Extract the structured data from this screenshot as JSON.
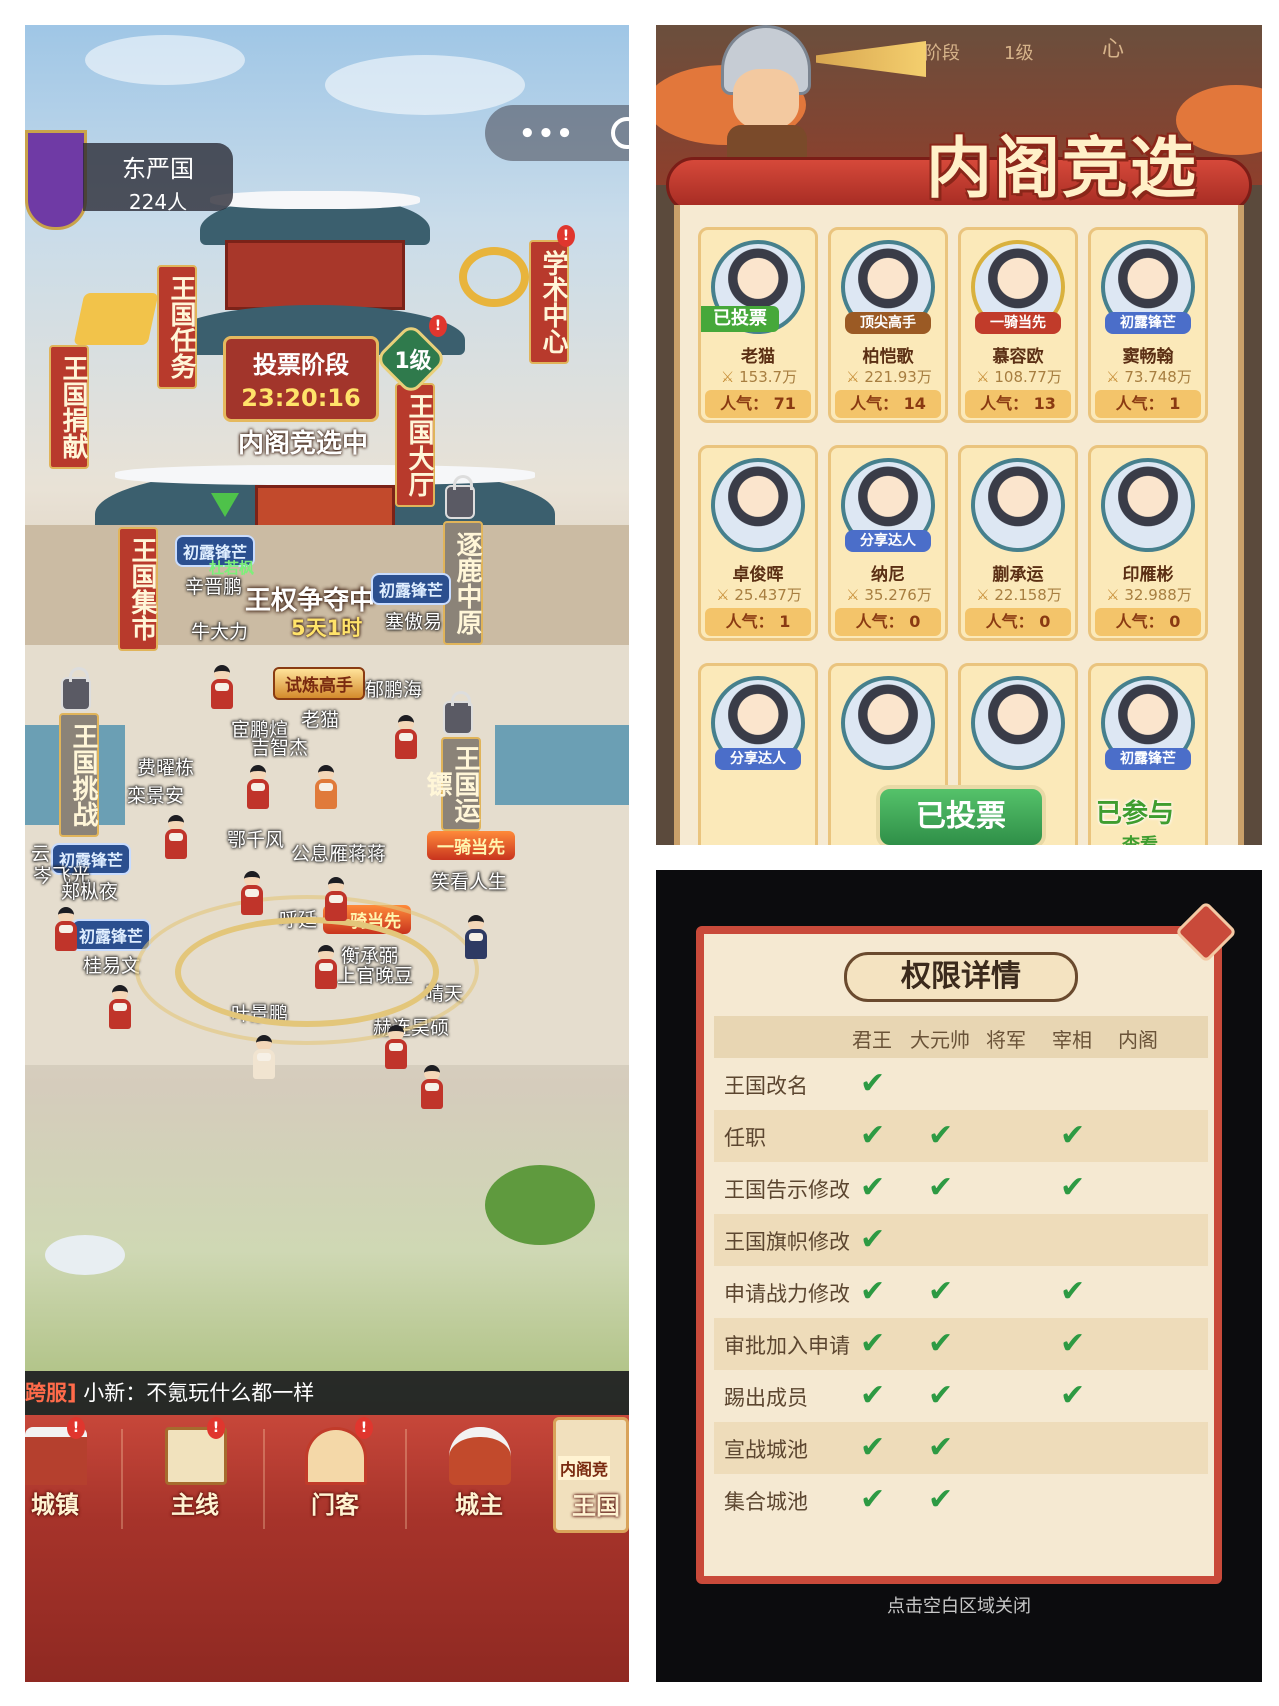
{
  "left_panel": {
    "kingdom": {
      "name": "东严国",
      "members": "224人"
    },
    "menu_dots": "•••",
    "side_banners": {
      "academy": "学术中心",
      "kingdom_tasks": "王国任务",
      "kingdom_donation": "王国捐献",
      "kingdom_hall": "王国大厅",
      "kingdom_market": "王国集市",
      "deer_hunt": "逐鹿中原",
      "kingdom_challenge": "王国挑战",
      "kingdom_escort": "王国运镖"
    },
    "vote_board": {
      "phase": "投票阶段",
      "timer": "23:20:16",
      "level": "1级",
      "status": "内阁竞选中"
    },
    "throne": {
      "title": "王权争夺中",
      "duration": "5天1时"
    },
    "titles": {
      "first_frost": "初露锋芒",
      "trial_master": "试炼高手",
      "rider": "一骑当先"
    },
    "characters": {
      "c1": "杜若枫",
      "c2": "辛晋鹏",
      "c3": "牛大力",
      "c4": "塞傲易",
      "c5": "郁鹏海",
      "c6": "宦鹏煊",
      "c7": "老猫",
      "c8": "吉智杰",
      "c9": "费曜栋",
      "c10": "栾景安",
      "c11": "鄂千风",
      "c12": "公息雁蒋蒋",
      "c13": "云",
      "c14": "岑飞光",
      "c15": "郏枞夜",
      "c16": "呼延",
      "c17": "笑看人生",
      "c18": "衡承弼",
      "c19": "上官晚豆",
      "c20": "桂易文",
      "c21": "晴天",
      "c22": "叶景鹏",
      "c23": "赫连昊硕"
    },
    "chat": {
      "tag": "跨服]",
      "message": "小新：不氪玩什么都一样"
    },
    "bottom_nav": [
      {
        "label": "城镇"
      },
      {
        "label": "主线"
      },
      {
        "label": "门客"
      },
      {
        "label": "城主"
      },
      {
        "label": "王国",
        "tag": "内阁竞"
      }
    ]
  },
  "election_panel": {
    "title": "内阁竞选",
    "header_fragment": {
      "a": "票阶段",
      "b": "1级",
      "c": "心"
    },
    "pop_label": "人气：",
    "candidates": [
      {
        "name": "老猫",
        "power": "153.7万",
        "pop": "71",
        "badge": "",
        "voted_badge": "已投票"
      },
      {
        "name": "柏恺歌",
        "power": "221.93万",
        "pop": "14",
        "badge": "顶尖高手"
      },
      {
        "name": "慕容欧",
        "power": "108.77万",
        "pop": "13",
        "badge": "一骑当先"
      },
      {
        "name": "窦畅翰",
        "power": "73.748万",
        "pop": "1",
        "badge": "初露锋芒"
      },
      {
        "name": "卓俊晖",
        "power": "25.437万",
        "pop": "1",
        "badge": ""
      },
      {
        "name": "纳尼",
        "power": "35.276万",
        "pop": "0",
        "badge": "分享达人"
      },
      {
        "name": "蒯承运",
        "power": "22.158万",
        "pop": "0",
        "badge": ""
      },
      {
        "name": "印雁彬",
        "power": "32.988万",
        "pop": "0",
        "badge": ""
      },
      {
        "badge": "分享达人"
      },
      {
        "badge": ""
      },
      {
        "badge": ""
      },
      {
        "badge": "初露锋芒"
      }
    ],
    "vote_button": "已投票",
    "joined_label": "已参与",
    "view_label": "查看"
  },
  "permissions_panel": {
    "title": "权限详情",
    "columns": [
      "君王",
      "大元帅",
      "将军",
      "宰相",
      "内阁"
    ],
    "check_glyph": "✔",
    "rows": [
      {
        "name": "王国改名",
        "checks": [
          true,
          false,
          false,
          false,
          false
        ]
      },
      {
        "name": "任职",
        "checks": [
          true,
          true,
          false,
          true,
          false
        ]
      },
      {
        "name": "王国告示修改",
        "checks": [
          true,
          true,
          false,
          true,
          false
        ]
      },
      {
        "name": "王国旗帜修改",
        "checks": [
          true,
          false,
          false,
          false,
          false
        ]
      },
      {
        "name": "申请战力修改",
        "checks": [
          true,
          true,
          false,
          true,
          false
        ]
      },
      {
        "name": "审批加入申请",
        "checks": [
          true,
          true,
          false,
          true,
          false
        ]
      },
      {
        "name": "踢出成员",
        "checks": [
          true,
          true,
          false,
          true,
          false
        ]
      },
      {
        "name": "宣战城池",
        "checks": [
          true,
          true,
          false,
          false,
          false
        ]
      },
      {
        "name": "集合城池",
        "checks": [
          true,
          true,
          false,
          false,
          false
        ]
      }
    ],
    "close_hint": "点击空白区域关闭"
  }
}
